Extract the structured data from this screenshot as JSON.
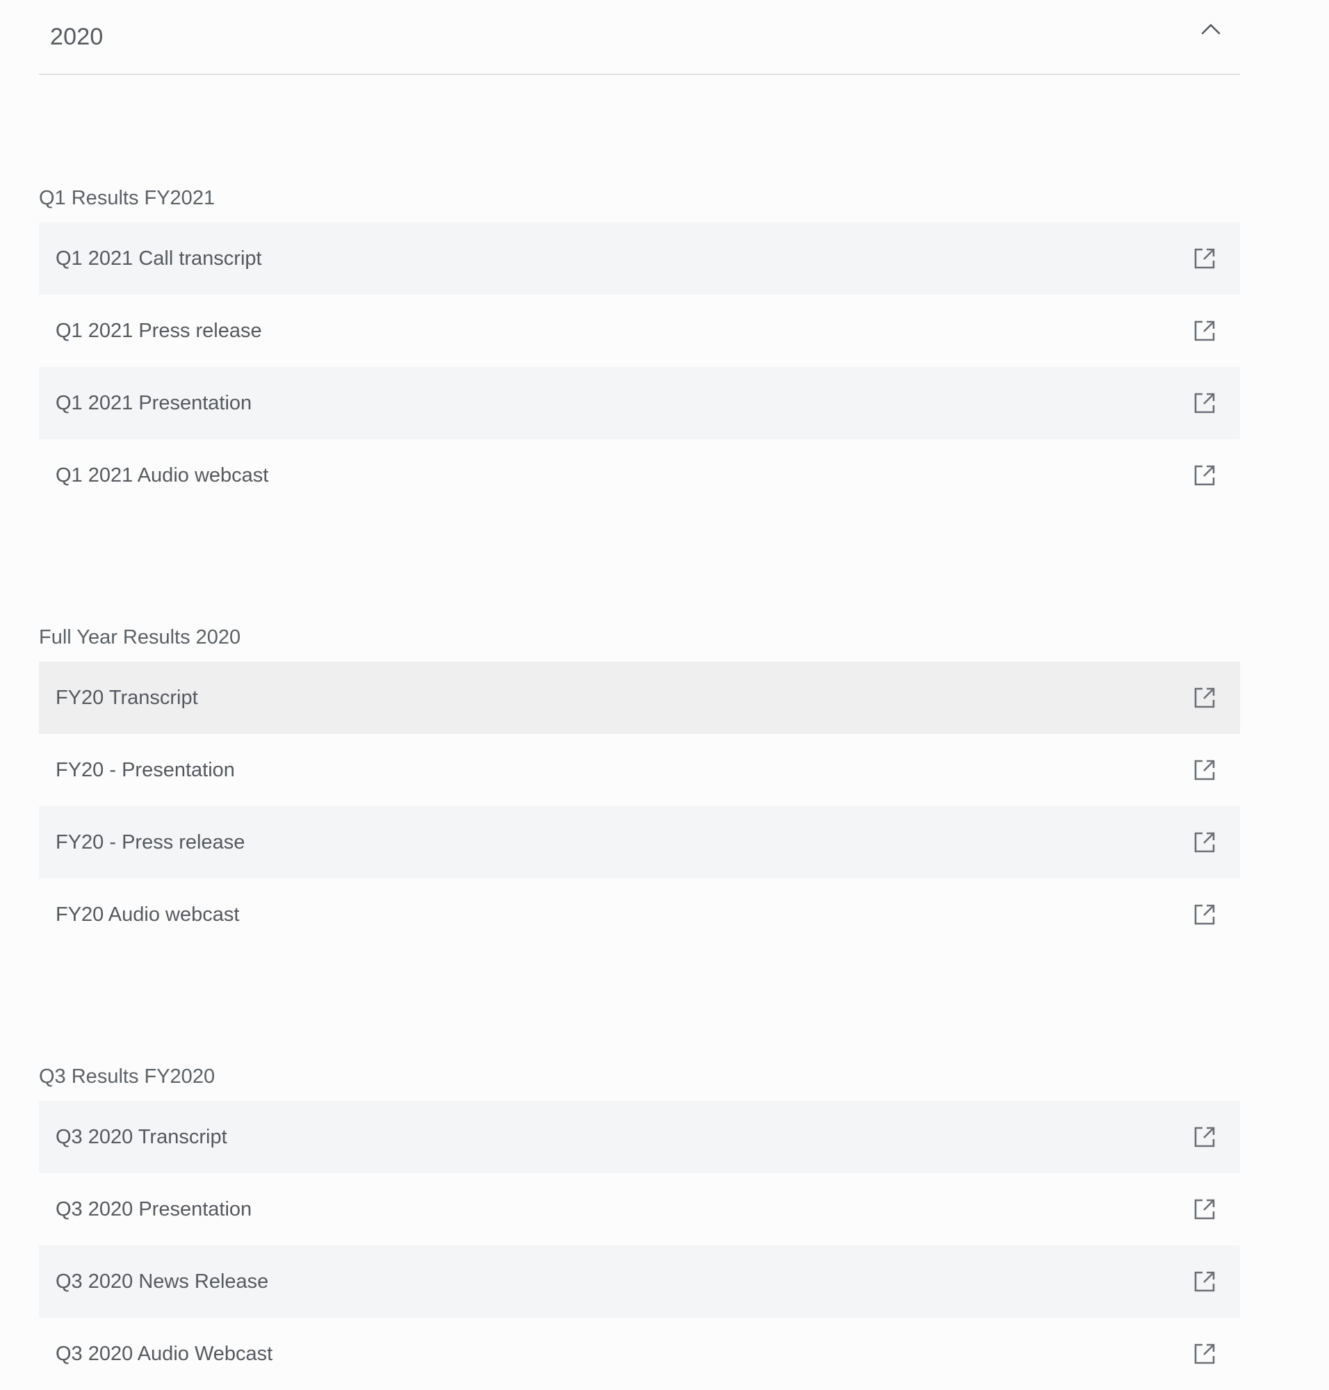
{
  "accordion": {
    "year": "2020",
    "expanded": true,
    "icon": "chevron-up-icon"
  },
  "groups": [
    {
      "title": "Q1 Results FY2021",
      "items": [
        {
          "label": "Q1 2021 Call transcript",
          "icon": "external-link-icon"
        },
        {
          "label": "Q1 2021 Press release",
          "icon": "external-link-icon"
        },
        {
          "label": "Q1 2021 Presentation",
          "icon": "external-link-icon"
        },
        {
          "label": "Q1 2021 Audio webcast",
          "icon": "external-link-icon"
        }
      ]
    },
    {
      "title": "Full Year Results 2020",
      "items": [
        {
          "label": "FY20 Transcript",
          "icon": "external-link-icon",
          "state": "hover"
        },
        {
          "label": "FY20 - Presentation",
          "icon": "external-link-icon"
        },
        {
          "label": "FY20 - Press release",
          "icon": "external-link-icon"
        },
        {
          "label": "FY20 Audio webcast",
          "icon": "external-link-icon"
        }
      ]
    },
    {
      "title": "Q3 Results FY2020",
      "items": [
        {
          "label": "Q3 2020 Transcript",
          "icon": "external-link-icon"
        },
        {
          "label": "Q3 2020 Presentation",
          "icon": "external-link-icon"
        },
        {
          "label": "Q3 2020 News Release",
          "icon": "external-link-icon"
        },
        {
          "label": "Q3 2020 Audio Webcast",
          "icon": "external-link-icon"
        }
      ]
    }
  ],
  "colors": {
    "page_background": "#fcfcfc",
    "row_shaded": "#f4f5f7",
    "row_hover": "#efeff0",
    "text": "#55595e",
    "divider": "#dfe1e4",
    "icon": "#6b6f74"
  }
}
